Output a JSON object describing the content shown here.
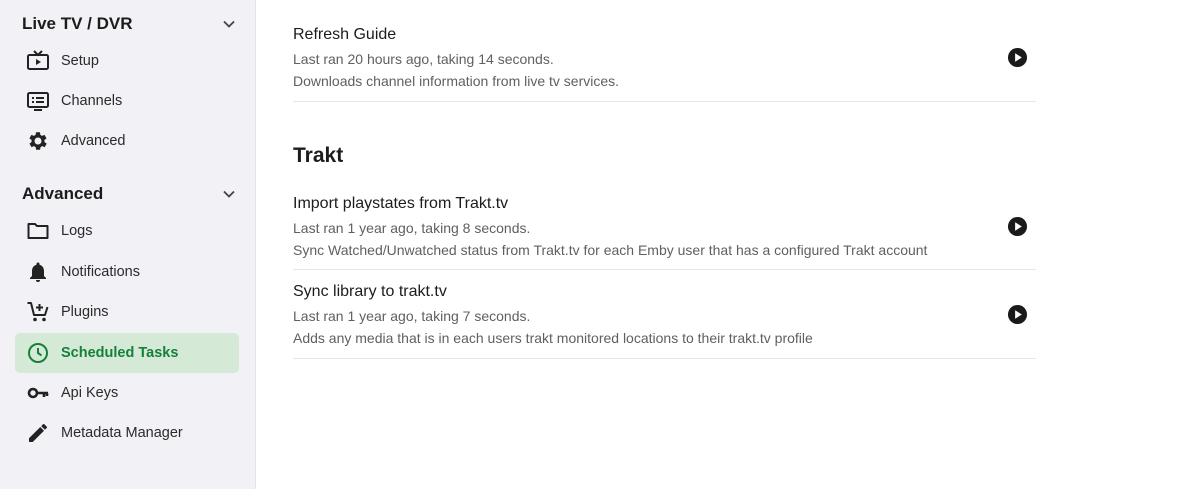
{
  "sidebar": {
    "sections": [
      {
        "title": "Live TV / DVR",
        "items": [
          {
            "label": "Setup",
            "icon": "live-tv-icon"
          },
          {
            "label": "Channels",
            "icon": "channels-list-icon"
          },
          {
            "label": "Advanced",
            "icon": "gear-icon"
          }
        ]
      },
      {
        "title": "Advanced",
        "items": [
          {
            "label": "Logs",
            "icon": "folder-icon"
          },
          {
            "label": "Notifications",
            "icon": "bell-icon"
          },
          {
            "label": "Plugins",
            "icon": "cart-plus-icon"
          },
          {
            "label": "Scheduled Tasks",
            "icon": "clock-icon",
            "active": true
          },
          {
            "label": "Api Keys",
            "icon": "key-icon"
          },
          {
            "label": "Metadata Manager",
            "icon": "pencil-icon"
          }
        ]
      }
    ]
  },
  "main": {
    "top_task": {
      "title": "Refresh Guide",
      "last_ran": "Last ran 20 hours ago, taking 14 seconds.",
      "description": "Downloads channel information from live tv services."
    },
    "group": {
      "title": "Trakt",
      "tasks": [
        {
          "title": "Import playstates from Trakt.tv",
          "last_ran": "Last ran 1 year ago, taking 8 seconds.",
          "description": "Sync Watched/Unwatched status from Trakt.tv for each Emby user that has a configured Trakt account"
        },
        {
          "title": "Sync library to trakt.tv",
          "last_ran": "Last ran 1 year ago, taking 7 seconds.",
          "description": "Adds any media that is in each users trakt monitored locations to their trakt.tv profile"
        }
      ]
    }
  },
  "colors": {
    "sidebar_bg": "#f1f1f6",
    "active_bg": "#d4ead7",
    "active_text": "#16803a"
  }
}
